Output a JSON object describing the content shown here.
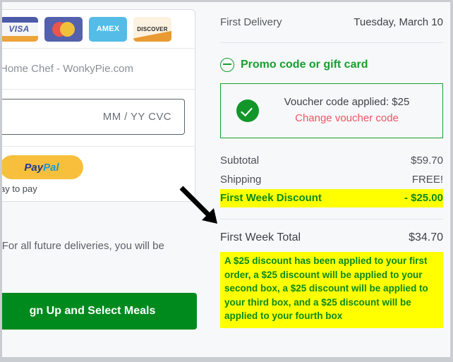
{
  "left_panel": {
    "card_logos": [
      {
        "name": "visa",
        "label": "VISA"
      },
      {
        "name": "mastercard",
        "label": ""
      },
      {
        "name": "amex",
        "label": "AMEX"
      },
      {
        "name": "discover",
        "label": "DISCOVER"
      }
    ],
    "name_field_placeholder": "Home Chef - WonkyPie.com",
    "card_field_placeholder": "MM / YY  CVC",
    "paypal_button": {
      "part_a": "Pay",
      "part_b": "Pal"
    },
    "paypal_sub_text": "ay to pay",
    "note_text": "ry. For all future deliveries, you will be",
    "signup_button_label": "gn Up and Select Meals"
  },
  "summary": {
    "first_delivery_label": "First Delivery",
    "first_delivery_value": "Tuesday, March 10",
    "promo_link_label": "Promo code or gift card",
    "promo_icon": "minus-circle-icon",
    "voucher": {
      "status_icon": "check-circle-icon",
      "applied_text": "Voucher code applied: $25",
      "change_link": "Change voucher code"
    },
    "lines": [
      {
        "label": "Subtotal",
        "value": "$59.70",
        "highlight": false
      },
      {
        "label": "Shipping",
        "value": "FREE!",
        "highlight": false
      },
      {
        "label": "First Week Discount",
        "value": "- $25.00",
        "highlight": true
      }
    ],
    "total_label": "First Week Total",
    "total_value": "$34.70",
    "discount_note": "A $25 discount has been applied to your first order, a $25 discount will be applied to your second box, a $25 discount will be applied to your third box, and a $25 discount will be applied to your fourth box"
  },
  "annotation": {
    "arrow_icon": "down-right-arrow-icon"
  },
  "colors": {
    "brand_green": "#16a02c",
    "highlight_yellow": "#ffff00",
    "link_red": "#ec5562",
    "button_green": "#008a1e",
    "paypal_yellow": "#f7bf3c"
  }
}
